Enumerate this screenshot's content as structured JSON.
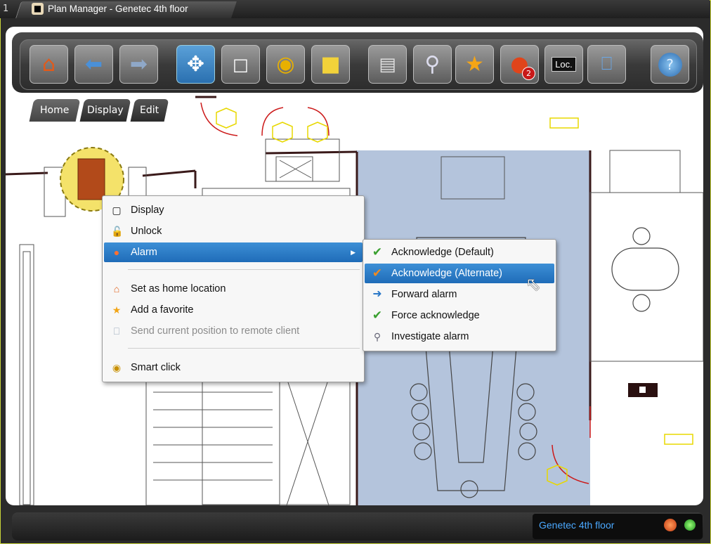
{
  "window": {
    "tab_number": "1",
    "title": "Plan Manager - Genetec 4th floor"
  },
  "toolbar": {
    "buttons": [
      {
        "name": "home",
        "icon": "home-icon"
      },
      {
        "name": "back",
        "icon": "arrow-left-icon"
      },
      {
        "name": "forward",
        "icon": "arrow-right-icon"
      },
      {
        "name": "pan",
        "icon": "move-icon"
      },
      {
        "name": "select",
        "icon": "select-icon"
      },
      {
        "name": "smart-click",
        "icon": "eye-icon"
      },
      {
        "name": "note",
        "icon": "sticky-note-icon"
      },
      {
        "name": "layers",
        "icon": "layers-icon"
      },
      {
        "name": "search",
        "icon": "search-icon"
      },
      {
        "name": "favorite",
        "icon": "star-icon"
      },
      {
        "name": "alarms",
        "icon": "alarm-icon",
        "badge": "2"
      },
      {
        "name": "location",
        "icon": "monitor-icon",
        "label": "Loc."
      },
      {
        "name": "remote",
        "icon": "network-icon"
      },
      {
        "name": "help",
        "icon": "help-icon"
      }
    ]
  },
  "tabs": [
    {
      "label": "Home"
    },
    {
      "label": "Display"
    },
    {
      "label": "Edit"
    }
  ],
  "context_menu": {
    "items": [
      {
        "label": "Display",
        "icon": "camera-icon"
      },
      {
        "label": "Unlock",
        "icon": "lock-icon"
      },
      {
        "label": "Alarm",
        "icon": "alarm-icon"
      },
      {
        "label": "Set as home location",
        "icon": "home-icon"
      },
      {
        "label": "Add a favorite",
        "icon": "star-icon"
      },
      {
        "label": "Send current position to remote client",
        "icon": "network-icon"
      },
      {
        "label": "Smart click",
        "icon": "eye-icon"
      }
    ]
  },
  "submenu": {
    "items": [
      {
        "label": "Acknowledge (Default)",
        "icon": "check-icon"
      },
      {
        "label": "Acknowledge (Alternate)",
        "icon": "check-icon"
      },
      {
        "label": "Forward alarm",
        "icon": "forward-icon"
      },
      {
        "label": "Force acknowledge",
        "icon": "force-check-icon"
      },
      {
        "label": "Investigate alarm",
        "icon": "search-icon"
      }
    ]
  },
  "status": {
    "location": "Genetec 4th floor"
  },
  "colors": {
    "accent": "#2a78c2",
    "frame": "#c8d43a",
    "status_text": "#4aa8ff",
    "wall_red": "#cc1a1a",
    "room_blue": "#b4c4dc"
  }
}
